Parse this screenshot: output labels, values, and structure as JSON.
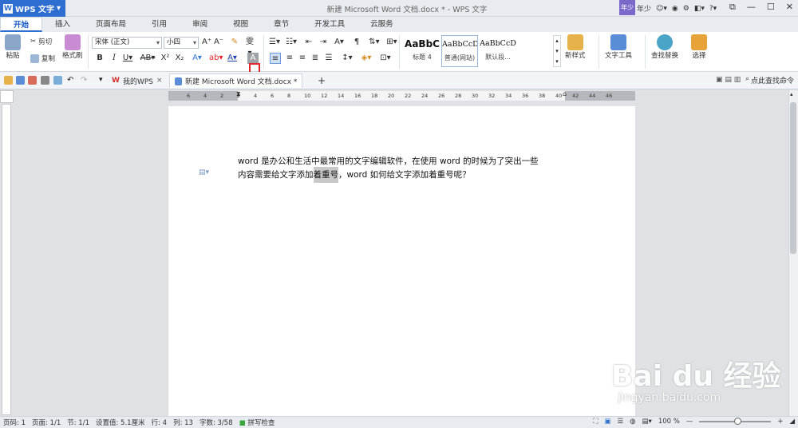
{
  "app": {
    "name": "WPS 文字",
    "title": "新建 Microsoft Word 文档.docx * - WPS 文字",
    "user_badge": "年少",
    "user_name": "年少"
  },
  "menu_tabs": [
    "开始",
    "插入",
    "页面布局",
    "引用",
    "审阅",
    "视图",
    "章节",
    "开发工具",
    "云服务"
  ],
  "ribbon": {
    "paste": "粘贴",
    "cut": "剪切",
    "copy": "复制",
    "format_painter": "格式刷",
    "font_name": "宋体 (正文)",
    "font_size": "小四",
    "styles": [
      {
        "sample": "AaBbC",
        "label": "标题 4"
      },
      {
        "sample": "AaBbCcD",
        "label": "普通(网站)"
      },
      {
        "sample": "AaBbCcD",
        "label": "默认段..."
      }
    ],
    "new_style": "新样式",
    "text_tools": "文字工具",
    "find_replace": "查找替换",
    "select": "选择"
  },
  "tabs": {
    "my_wps": "我的WPS",
    "doc": "新建 Microsoft Word 文档.docx *",
    "search_cmd": "点此查找命令"
  },
  "ruler_ticks": [
    "6",
    "4",
    "2",
    "2",
    "4",
    "6",
    "8",
    "10",
    "12",
    "14",
    "16",
    "18",
    "20",
    "22",
    "24",
    "26",
    "28",
    "30",
    "32",
    "34",
    "36",
    "38",
    "40",
    "42",
    "44",
    "46"
  ],
  "document": {
    "line1": "word 是办公和生活中最常用的文字编辑软件，在使用 word 的时候为了突出一些",
    "line2_pre": "内容需要给文字添加",
    "line2_hl": "着重号",
    "line2_post": "，word 如何给文字添加着重号呢？"
  },
  "status": {
    "page_num": "页码: 1",
    "pages": "页面: 1/1",
    "section": "节: 1/1",
    "setting": "设置值: 5.1厘米",
    "row": "行: 4",
    "col": "列: 13",
    "words": "字数: 3/58",
    "spell": "拼写检查",
    "zoom": "100 %",
    "zoom_fraction": 0.53
  },
  "watermark": {
    "text": "Bai du 经验",
    "url": "jingyan.baidu.com"
  },
  "colors": {
    "accent": "#2e6ed0",
    "highlight_box": "#e3262b"
  }
}
